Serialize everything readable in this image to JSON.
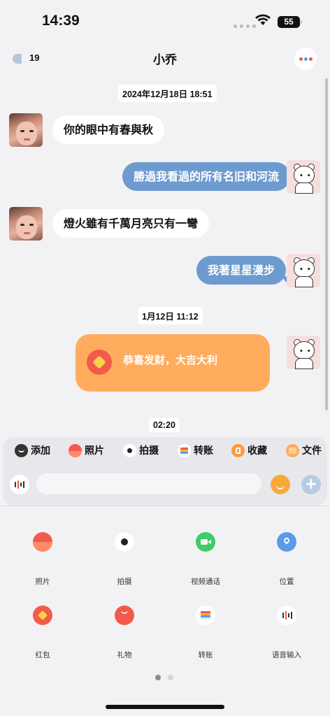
{
  "status_bar": {
    "time": "14:39",
    "battery": "55"
  },
  "header": {
    "back_count": "19",
    "title": "小乔"
  },
  "messages": [
    {
      "type": "timestamp",
      "text": "2024年12月18日 18:51"
    },
    {
      "type": "incoming",
      "text": "你的眼中有春與秋"
    },
    {
      "type": "outgoing",
      "text": "勝過我看過的所有名旧和河流"
    },
    {
      "type": "incoming",
      "text": "燈火雖有千萬月亮只有一彎"
    },
    {
      "type": "outgoing",
      "text": "我著星星漫步"
    },
    {
      "type": "timestamp",
      "text": "1月12日 11:12"
    },
    {
      "type": "red_packet",
      "text": "恭喜发财，大吉大利"
    },
    {
      "type": "timestamp",
      "text": "02:20"
    }
  ],
  "quick_actions": [
    {
      "label": "添加",
      "icon": "add-icon",
      "color": "#333333"
    },
    {
      "label": "照片",
      "icon": "photo-icon",
      "color": "#f25a4a"
    },
    {
      "label": "拍摄",
      "icon": "camera-icon",
      "color": "#ffffff"
    },
    {
      "label": "转账",
      "icon": "transfer-icon",
      "color": "#ffffff"
    },
    {
      "label": "收藏",
      "icon": "favorite-icon",
      "color": "#ff9a3c"
    },
    {
      "label": "文件",
      "icon": "file-icon",
      "color": "#ffac5e"
    }
  ],
  "input": {
    "placeholder": ""
  },
  "more_panel": [
    {
      "label": "照片",
      "icon": "photo-icon",
      "color": "#f25a4a"
    },
    {
      "label": "拍摄",
      "icon": "camera-icon",
      "color": "#ffffff"
    },
    {
      "label": "视频通话",
      "icon": "video-call-icon",
      "color": "#3ecb6a"
    },
    {
      "label": "位置",
      "icon": "location-icon",
      "color": "#5a9bea"
    },
    {
      "label": "红包",
      "icon": "red-packet-icon",
      "color": "#f25a4a"
    },
    {
      "label": "礼物",
      "icon": "gift-icon",
      "color": "#f25a4a"
    },
    {
      "label": "转账",
      "icon": "transfer-icon",
      "color": "#ffffff"
    },
    {
      "label": "语音输入",
      "icon": "voice-input-icon",
      "color": "#ffffff"
    }
  ],
  "colors": {
    "outgoing_bubble": "#6d9bd0",
    "red_packet": "#ffac5e",
    "background": "#f2f2f4"
  }
}
